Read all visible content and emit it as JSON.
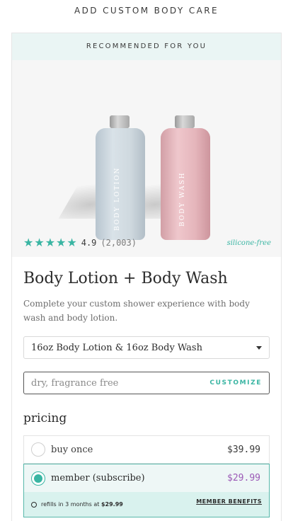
{
  "header": {
    "title": "ADD CUSTOM BODY CARE"
  },
  "card": {
    "banner": "RECOMMENDED FOR YOU",
    "hero": {
      "bottles": [
        {
          "label": "BODY LOTION",
          "color": "#d3dde3"
        },
        {
          "label": "BODY WASH",
          "color": "#e9bcc1"
        }
      ]
    },
    "rating": {
      "stars": 5,
      "star_icon": "star-icon",
      "star_color": "#3ab5a3",
      "value": "4.9",
      "count": "(2,003)",
      "tag": "silicone-free"
    },
    "title": "Body Lotion + Body Wash",
    "description": "Complete your custom shower experience with body wash and body lotion.",
    "size_select": {
      "value": "16oz Body Lotion & 16oz Body Wash"
    },
    "customize": {
      "placeholder": "dry, fragrance free",
      "button_label": "CUSTOMIZE"
    },
    "pricing": {
      "heading": "pricing",
      "options": [
        {
          "label": "buy once",
          "price": "$39.99",
          "selected": false
        },
        {
          "label": "member (subscribe)",
          "price": "$29.99",
          "selected": true
        }
      ],
      "member_note_prefix": "refills in 3 months at ",
      "member_note_price": "$29.99",
      "member_benefits_label": "MEMBER BENEFITS"
    }
  },
  "colors": {
    "accent": "#3ab5a3",
    "banner_bg": "#eaf5f4",
    "member_price": "#9b59b6",
    "member_bar_bg": "#d9f2ee"
  }
}
